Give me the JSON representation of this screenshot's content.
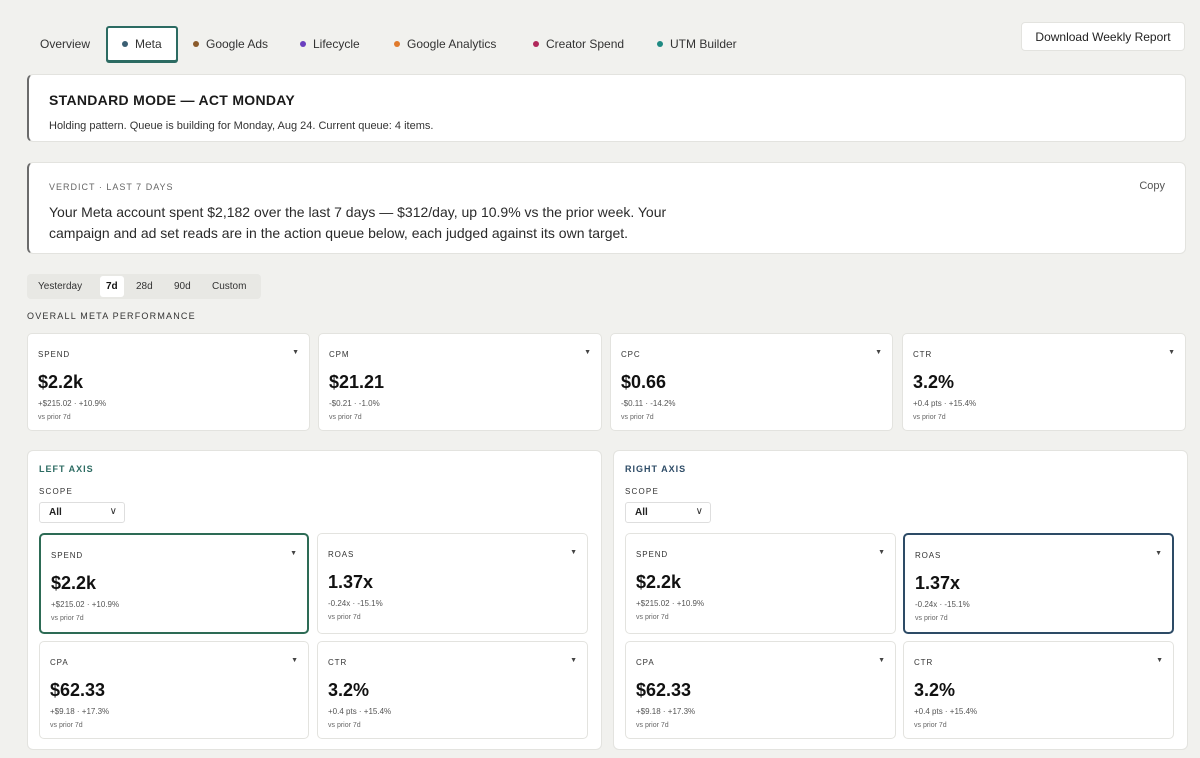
{
  "nav": {
    "tabs": [
      {
        "label": "Overview",
        "dot": null
      },
      {
        "label": "Meta",
        "dot": "#3b5f73"
      },
      {
        "label": "Google Ads",
        "dot": "#8a5a2b"
      },
      {
        "label": "Lifecycle",
        "dot": "#6a3fbf"
      },
      {
        "label": "Google Analytics",
        "dot": "#e07a2c"
      },
      {
        "label": "Creator Spend",
        "dot": "#b0285a"
      },
      {
        "label": "UTM Builder",
        "dot": "#1f8a82"
      }
    ],
    "active_tab": "Meta",
    "download_label": "Download Weekly Report"
  },
  "mode_banner": {
    "title": "STANDARD MODE — ACT MONDAY",
    "text": "Holding pattern. Queue is building for Monday, Aug 24. Current queue: 4 items."
  },
  "verdict": {
    "label": "VERDICT · LAST 7 DAYS",
    "text": "Your Meta account spent $2,182 over the last 7 days — $312/day, up 10.9% vs the prior week. Your campaign and ad set reads are in the action queue below, each judged against its own target.",
    "copy_label": "Copy"
  },
  "range": {
    "options": [
      "Yesterday",
      "7d",
      "28d",
      "90d",
      "Custom"
    ],
    "active": "7d"
  },
  "overall": {
    "label": "OVERALL META PERFORMANCE",
    "cards": [
      {
        "label": "SPEND",
        "value": "$2.2k",
        "delta": "+$215.02 · +10.9%",
        "sub": "vs prior 7d"
      },
      {
        "label": "CPM",
        "value": "$21.21",
        "delta": "-$0.21 · -1.0%",
        "sub": "vs prior 7d"
      },
      {
        "label": "CPC",
        "value": "$0.66",
        "delta": "-$0.11 · -14.2%",
        "sub": "vs prior 7d"
      },
      {
        "label": "CTR",
        "value": "3.2%",
        "delta": "+0.4 pts · +15.4%",
        "sub": "vs prior 7d"
      }
    ]
  },
  "left_axis": {
    "title": "LEFT AXIS",
    "scope_label": "SCOPE",
    "scope_value": "All",
    "cards": [
      {
        "label": "SPEND",
        "value": "$2.2k",
        "delta": "+$215.02 · +10.9%",
        "sub": "vs prior 7d"
      },
      {
        "label": "ROAS",
        "value": "1.37x",
        "delta": "-0.24x · -15.1%",
        "sub": "vs prior 7d"
      },
      {
        "label": "CPA",
        "value": "$62.33",
        "delta": "+$9.18 · +17.3%",
        "sub": "vs prior 7d"
      },
      {
        "label": "CTR",
        "value": "3.2%",
        "delta": "+0.4 pts · +15.4%",
        "sub": "vs prior 7d"
      }
    ]
  },
  "right_axis": {
    "title": "RIGHT AXIS",
    "scope_label": "SCOPE",
    "scope_value": "All",
    "cards": [
      {
        "label": "SPEND",
        "value": "$2.2k",
        "delta": "+$215.02 · +10.9%",
        "sub": "vs prior 7d"
      },
      {
        "label": "ROAS",
        "value": "1.37x",
        "delta": "-0.24x · -15.1%",
        "sub": "vs prior 7d"
      },
      {
        "label": "CPA",
        "value": "$62.33",
        "delta": "+$9.18 · +17.3%",
        "sub": "vs prior 7d"
      },
      {
        "label": "CTR",
        "value": "3.2%",
        "delta": "+0.4 pts · +15.4%",
        "sub": "vs prior 7d"
      }
    ]
  },
  "colors": {
    "accent_green": "#2c6b62",
    "accent_blue": "#2d4b66"
  }
}
